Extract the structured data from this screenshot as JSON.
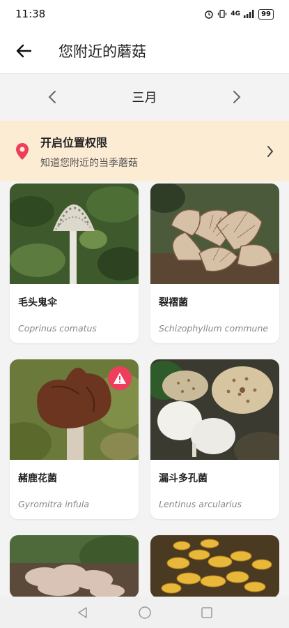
{
  "status": {
    "time": "11:38",
    "network": "4G",
    "battery": "99"
  },
  "appbar": {
    "title": "您附近的蘑菇"
  },
  "month": {
    "label": "三月"
  },
  "location_banner": {
    "title": "开启位置权限",
    "subtitle": "知道您附近的当季蘑菇"
  },
  "cards": [
    {
      "cn": "毛头鬼伞",
      "latin": "Coprinus comatus",
      "warning": false
    },
    {
      "cn": "裂褶菌",
      "latin": "Schizophyllum commune",
      "warning": false
    },
    {
      "cn": "赭鹿花菌",
      "latin": "Gyromitra infula",
      "warning": true
    },
    {
      "cn": "漏斗多孔菌",
      "latin": "Lentinus arcularius",
      "warning": false
    }
  ],
  "colors": {
    "accent_pink": "#ee3e5c",
    "banner_bg": "#fdecd4"
  }
}
